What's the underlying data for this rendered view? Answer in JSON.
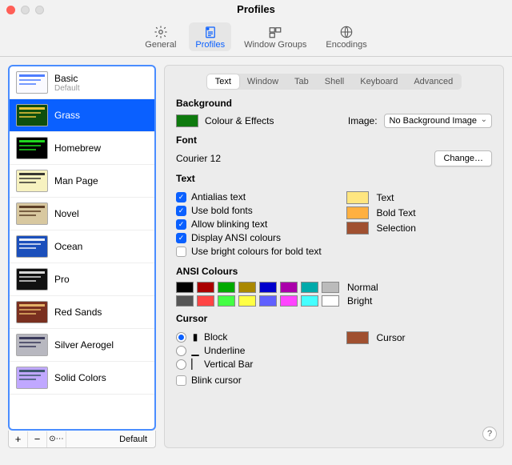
{
  "window": {
    "title": "Profiles"
  },
  "toolbar": {
    "items": [
      {
        "id": "general",
        "label": "General"
      },
      {
        "id": "profiles",
        "label": "Profiles"
      },
      {
        "id": "window-groups",
        "label": "Window Groups"
      },
      {
        "id": "encodings",
        "label": "Encodings"
      }
    ],
    "selected": "profiles"
  },
  "sidebar": {
    "profiles": [
      {
        "name": "Basic",
        "subtitle": "Default",
        "bg": "#fafaff",
        "fg": "#3b6fff"
      },
      {
        "name": "Grass",
        "bg": "#0e4f0e",
        "fg": "#ffd040"
      },
      {
        "name": "Homebrew",
        "bg": "#000000",
        "fg": "#22ee22"
      },
      {
        "name": "Man Page",
        "bg": "#f7f2c0",
        "fg": "#222"
      },
      {
        "name": "Novel",
        "bg": "#d8c8a0",
        "fg": "#503018"
      },
      {
        "name": "Ocean",
        "bg": "#1b4fbb",
        "fg": "#ffffff"
      },
      {
        "name": "Pro",
        "bg": "#111111",
        "fg": "#eeeeee"
      },
      {
        "name": "Red Sands",
        "bg": "#7a3020",
        "fg": "#eec070"
      },
      {
        "name": "Silver Aerogel",
        "bg": "#b8b8c0",
        "fg": "#2c2c50"
      },
      {
        "name": "Solid Colors",
        "bg": "#c0a8ff",
        "fg": "#305060"
      }
    ],
    "selected_index": 1,
    "buttons": {
      "add": "+",
      "remove": "−",
      "menu": "⊙⋯",
      "default_btn": "Default"
    }
  },
  "detail_tabs": {
    "items": [
      "Text",
      "Window",
      "Tab",
      "Shell",
      "Keyboard",
      "Advanced"
    ],
    "selected": 0
  },
  "background": {
    "heading": "Background",
    "colour_effects_label": "Colour & Effects",
    "colour": "#0e7a0e",
    "image_label": "Image:",
    "image_select_value": "No Background Image"
  },
  "font": {
    "heading": "Font",
    "value": "Courier 12",
    "change_label": "Change…"
  },
  "text": {
    "heading": "Text",
    "options": [
      {
        "label": "Antialias text",
        "checked": true
      },
      {
        "label": "Use bold fonts",
        "checked": true
      },
      {
        "label": "Allow blinking text",
        "checked": true
      },
      {
        "label": "Display ANSI colours",
        "checked": true
      },
      {
        "label": "Use bright colours for bold text",
        "checked": false
      }
    ],
    "swatch_labels": [
      "Text",
      "Bold Text",
      "Selection"
    ],
    "swatches": [
      "#ffe680",
      "#ffb040",
      "#a05030"
    ]
  },
  "ansi": {
    "heading": "ANSI Colours",
    "normal_label": "Normal",
    "bright_label": "Bright",
    "normal": [
      "#000000",
      "#aa0000",
      "#00aa00",
      "#aa8800",
      "#0000cc",
      "#aa00aa",
      "#00aaaa",
      "#bbbbbb"
    ],
    "bright": [
      "#555555",
      "#ff4444",
      "#44ff44",
      "#ffff44",
      "#6060ff",
      "#ff44ff",
      "#44ffff",
      "#ffffff"
    ]
  },
  "cursor": {
    "heading": "Cursor",
    "options": [
      {
        "label": "Block",
        "glyph": "▮",
        "selected": true
      },
      {
        "label": "Underline",
        "glyph": "▁",
        "selected": false
      },
      {
        "label": "Vertical Bar",
        "glyph": "▏",
        "selected": false
      }
    ],
    "blink_label": "Blink cursor",
    "blink_checked": false,
    "swatch_label": "Cursor",
    "swatch": "#a05030"
  },
  "help": "?"
}
